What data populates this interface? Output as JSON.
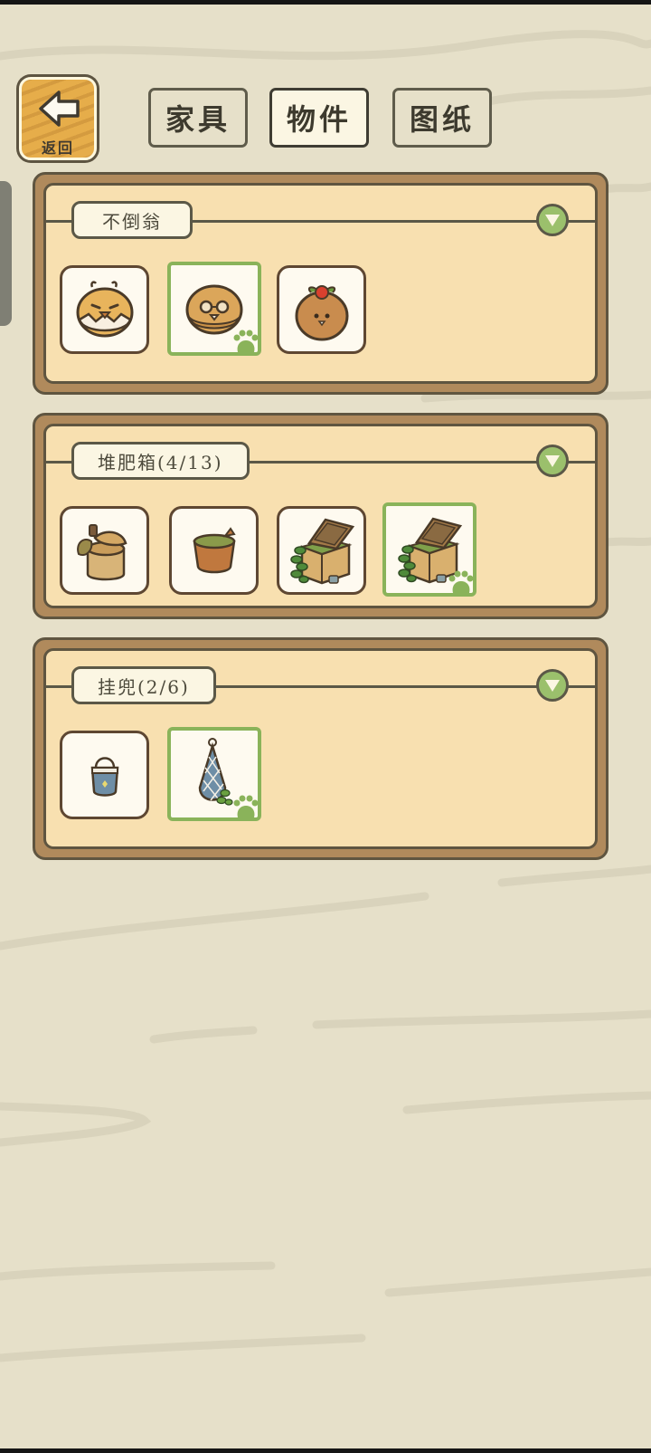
{
  "header": {
    "back_label": "返回",
    "tabs": [
      {
        "label": "家具",
        "active": false
      },
      {
        "label": "物件",
        "active": true
      },
      {
        "label": "图纸",
        "active": false
      }
    ]
  },
  "sections": [
    {
      "title": "不倒翁",
      "items": [
        {
          "icon": "chick-tumbler-icon",
          "selected": false
        },
        {
          "icon": "glasses-tumbler-icon",
          "selected": true
        },
        {
          "icon": "berry-tumbler-icon",
          "selected": false
        }
      ]
    },
    {
      "title": "堆肥箱(4/13)",
      "items": [
        {
          "icon": "compost-barrel-leaf-icon",
          "selected": false
        },
        {
          "icon": "compost-barrel-open-icon",
          "selected": false
        },
        {
          "icon": "compost-crate-vine-icon",
          "selected": false
        },
        {
          "icon": "compost-crate-vine-icon",
          "selected": true
        }
      ]
    },
    {
      "title": "挂兜(2/6)",
      "items": [
        {
          "icon": "hanging-pouch-icon",
          "selected": false
        },
        {
          "icon": "net-bag-icon",
          "selected": true
        }
      ]
    }
  ],
  "colors": {
    "background": "#e6e0c9",
    "panel_frame": "#b08a5c",
    "panel_inner": "#f8e0b0",
    "selected_border": "#8ab35a",
    "toggle": "#9bc06c",
    "back_button": "#e6ad4a"
  }
}
